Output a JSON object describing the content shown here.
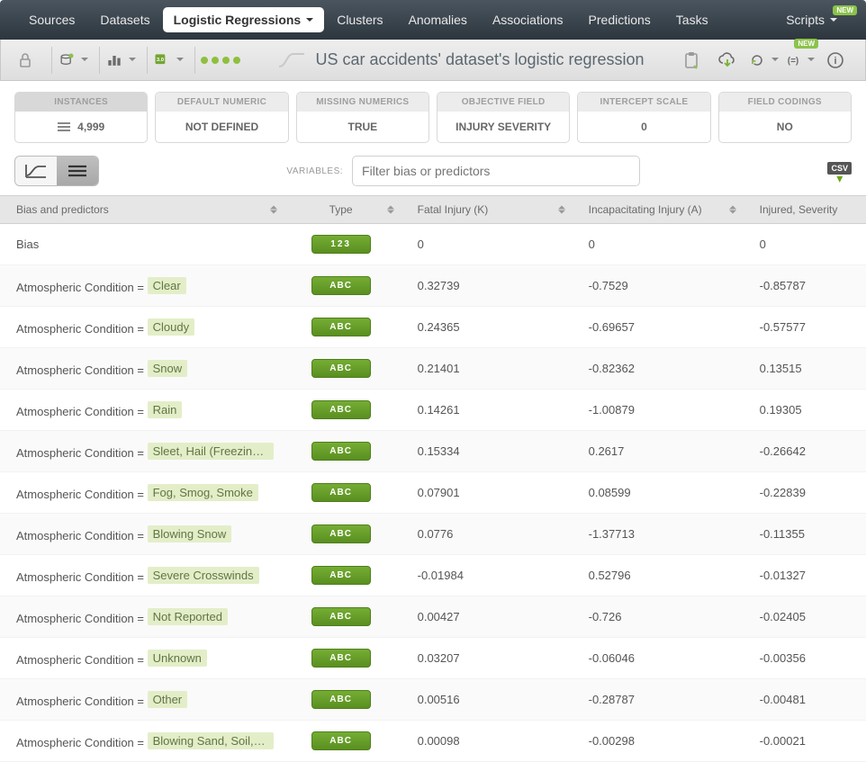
{
  "nav": {
    "items": [
      "Sources",
      "Datasets",
      "Logistic Regressions",
      "Clusters",
      "Anomalies",
      "Associations",
      "Predictions",
      "Tasks"
    ],
    "active_index": 2,
    "right": {
      "label": "Scripts",
      "badge": "NEW"
    }
  },
  "toolbar": {
    "title": "US car accidents' dataset's logistic regression",
    "badge_new": "NEW"
  },
  "cards": [
    {
      "head": "INSTANCES",
      "value": "4,999",
      "show_icon": true
    },
    {
      "head": "DEFAULT NUMERIC",
      "value": "NOT DEFINED"
    },
    {
      "head": "MISSING NUMERICS",
      "value": "TRUE"
    },
    {
      "head": "OBJECTIVE FIELD",
      "value": "INJURY SEVERITY"
    },
    {
      "head": "INTERCEPT SCALE",
      "value": "0"
    },
    {
      "head": "FIELD CODINGS",
      "value": "NO"
    }
  ],
  "variables_bar": {
    "label": "VARIABLES:",
    "placeholder": "Filter bias or predictors",
    "csv_label": "CSV"
  },
  "columns": [
    "Bias and predictors",
    "Type",
    "Fatal Injury (K)",
    "Incapacitating Injury (A)",
    "Injured, Severity"
  ],
  "type_labels": {
    "numeric": "123",
    "text": "ABC"
  },
  "predictor_prefix": "Atmospheric Condition = ",
  "rows": [
    {
      "label": "Bias",
      "chip": null,
      "type": "numeric",
      "c1": "0",
      "c2": "0",
      "c3": "0"
    },
    {
      "label": "",
      "chip": "Clear",
      "type": "text",
      "c1": "0.32739",
      "c2": "-0.7529",
      "c3": "-0.85787"
    },
    {
      "label": "",
      "chip": "Cloudy",
      "type": "text",
      "c1": "0.24365",
      "c2": "-0.69657",
      "c3": "-0.57577"
    },
    {
      "label": "",
      "chip": "Snow",
      "type": "text",
      "c1": "0.21401",
      "c2": "-0.82362",
      "c3": "0.13515"
    },
    {
      "label": "",
      "chip": "Rain",
      "type": "text",
      "c1": "0.14261",
      "c2": "-1.00879",
      "c3": "0.19305"
    },
    {
      "label": "",
      "chip": "Sleet, Hail (Freezing Ra…",
      "type": "text",
      "c1": "0.15334",
      "c2": "0.2617",
      "c3": "-0.26642"
    },
    {
      "label": "",
      "chip": "Fog, Smog, Smoke",
      "type": "text",
      "c1": "0.07901",
      "c2": "0.08599",
      "c3": "-0.22839"
    },
    {
      "label": "",
      "chip": "Blowing Snow",
      "type": "text",
      "c1": "0.0776",
      "c2": "-1.37713",
      "c3": "-0.11355"
    },
    {
      "label": "",
      "chip": "Severe Crosswinds",
      "type": "text",
      "c1": "-0.01984",
      "c2": "0.52796",
      "c3": "-0.01327"
    },
    {
      "label": "",
      "chip": "Not Reported",
      "type": "text",
      "c1": "0.00427",
      "c2": "-0.726",
      "c3": "-0.02405"
    },
    {
      "label": "",
      "chip": "Unknown",
      "type": "text",
      "c1": "0.03207",
      "c2": "-0.06046",
      "c3": "-0.00356"
    },
    {
      "label": "",
      "chip": "Other",
      "type": "text",
      "c1": "0.00516",
      "c2": "-0.28787",
      "c3": "-0.00481"
    },
    {
      "label": "",
      "chip": "Blowing Sand, Soil, Dirt",
      "type": "text",
      "c1": "0.00098",
      "c2": "-0.00298",
      "c3": "-0.00021"
    }
  ]
}
